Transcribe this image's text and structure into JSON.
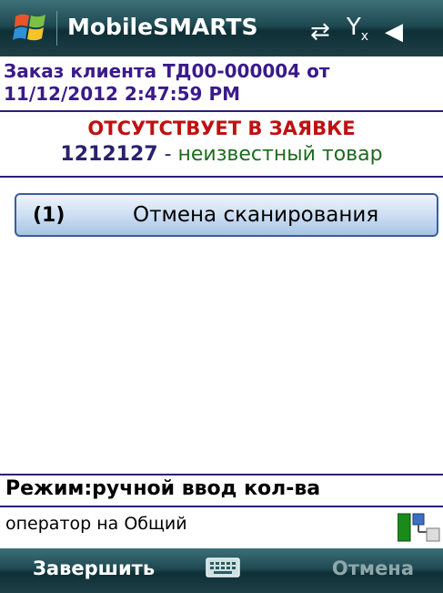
{
  "titlebar": {
    "app_title": "MobileSMARTS",
    "icons": [
      "windows-logo",
      "sync-icon",
      "signal-off-icon",
      "volume-icon"
    ]
  },
  "order": {
    "text": "Заказ клиента ТД00-000004 от 11/12/2012 2:47:59 PM"
  },
  "status": {
    "missing_text": "ОТСУТСТВУЕТ В ЗАЯВКЕ",
    "item_code": "1212127",
    "separator": "-",
    "item_desc": "неизвестный товар"
  },
  "actions": [
    {
      "num": "(1)",
      "label": "Отмена сканирования"
    }
  ],
  "footer": {
    "mode": "Режим:ручной ввод кол-ва",
    "operator": "оператор на Общий"
  },
  "softkeys": {
    "left": "Завершить",
    "right": "Отмена"
  },
  "colors": {
    "title_bg": "#1f4a52",
    "order_text": "#3a1a8a",
    "missing_text": "#c01010",
    "item_desc": "#1e6b1e",
    "button_border": "#3b5d9c"
  }
}
